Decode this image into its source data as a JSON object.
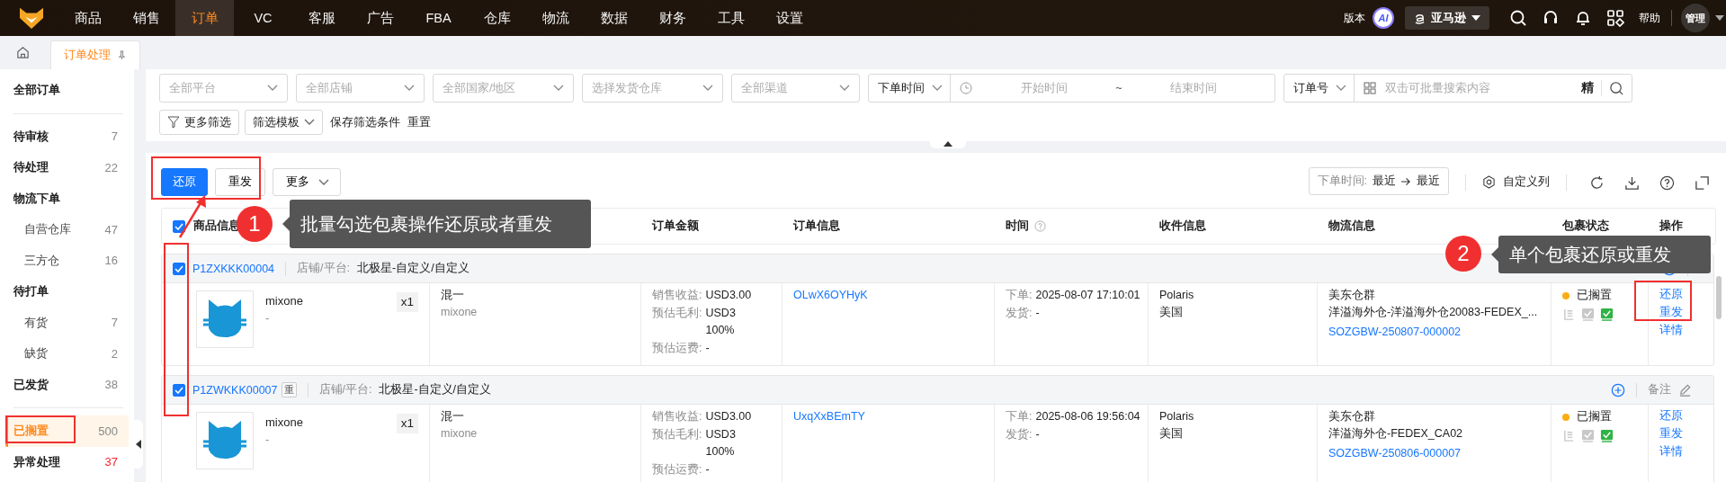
{
  "nav": {
    "items": [
      {
        "label": "商品",
        "selected": false
      },
      {
        "label": "销售",
        "selected": false
      },
      {
        "label": "订单",
        "selected": true
      },
      {
        "label": "VC",
        "selected": false
      },
      {
        "label": "客服",
        "selected": false
      },
      {
        "label": "广告",
        "selected": false
      },
      {
        "label": "FBA",
        "selected": false
      },
      {
        "label": "仓库",
        "selected": false
      },
      {
        "label": "物流",
        "selected": false
      },
      {
        "label": "数据",
        "selected": false
      },
      {
        "label": "财务",
        "selected": false
      },
      {
        "label": "工具",
        "selected": false
      },
      {
        "label": "设置",
        "selected": false
      }
    ],
    "version": "版本",
    "ai": "AI",
    "platform": "亚马逊",
    "help": "帮助",
    "user": "管理"
  },
  "tabs": [
    {
      "label": "订单处理",
      "selected": true
    }
  ],
  "sidebar": {
    "sections": [
      {
        "items": [
          {
            "label": "全部订单",
            "selected": false
          }
        ]
      },
      {
        "items": [
          {
            "label": "待审核",
            "count": "7",
            "alert": false,
            "selected": false
          },
          {
            "label": "待处理",
            "count": "22",
            "alert": false,
            "selected": false
          },
          {
            "label": "物流下单",
            "selected": false,
            "children": [
              {
                "label": "自营仓库",
                "count": "47",
                "alert": false,
                "selected": false
              },
              {
                "label": "三方仓",
                "count": "16",
                "alert": false,
                "selected": false
              }
            ]
          },
          {
            "label": "待打单",
            "selected": false,
            "children": [
              {
                "label": "有货",
                "count": "7",
                "alert": false,
                "selected": false
              },
              {
                "label": "缺货",
                "count": "2",
                "alert": false,
                "selected": false
              }
            ]
          },
          {
            "label": "已发货",
            "count": "38",
            "alert": false,
            "selected": false
          }
        ]
      },
      {
        "items": [
          {
            "label": "已搁置",
            "count": "500",
            "alert": false,
            "selected": true
          },
          {
            "label": "异常处理",
            "count": "37",
            "alert": true,
            "selected": false
          }
        ]
      }
    ]
  },
  "filters": {
    "selects": [
      {
        "placeholder": "全部平台"
      },
      {
        "placeholder": "全部店铺"
      },
      {
        "placeholder": "全部国家/地区"
      },
      {
        "placeholder": "选择发货仓库"
      },
      {
        "placeholder": "全部渠道"
      }
    ],
    "date": {
      "field": "下单时间",
      "start_placeholder": "开始时间",
      "separator": "~",
      "end_placeholder": "结束时间"
    },
    "search": {
      "field": "订单号",
      "placeholder": "双击可批量搜索内容",
      "exact": "精"
    },
    "more": "更多筛选",
    "template": "筛选模板",
    "save": "保存筛选条件",
    "reset": "重置"
  },
  "toolbar": {
    "buttons": [
      {
        "label": "还原",
        "kind": "primary"
      },
      {
        "label": "重发",
        "kind": "default"
      },
      {
        "label": "更多",
        "kind": "dropdown"
      }
    ],
    "sort": {
      "label": "下单时间:",
      "from": "最近",
      "to": "最近"
    },
    "customize": "自定义列"
  },
  "table": {
    "select_all": {
      "checked": true
    },
    "columns": [
      {
        "label": "商品信息"
      },
      {
        "label": "订单金额"
      },
      {
        "label": "订单信息"
      },
      {
        "label": "时间",
        "help": true
      },
      {
        "label": "收件信息"
      },
      {
        "label": "物流信息"
      },
      {
        "label": "包裹状态"
      },
      {
        "label": "操作"
      }
    ],
    "rows": [
      {
        "checked": true,
        "order_no": "P1ZXKKK00004",
        "shop_label": "店铺/平台:",
        "shop": "北极星-自定义/自定义",
        "product": {
          "name": "mixone",
          "sku": "-",
          "qty": "x1"
        },
        "variant": {
          "name": "混一",
          "sku": "mixone"
        },
        "amount": [
          {
            "caption": "销售收益:",
            "text": "USD3.00"
          },
          {
            "caption": "预估毛利:",
            "text": "USD3",
            "extra": "100%"
          },
          {
            "caption": "预估运费:",
            "text": "-"
          }
        ],
        "order_id": "OLwX6OYHyK",
        "time": [
          {
            "caption": "下单:",
            "text": "2025-08-07 17:10:01"
          },
          {
            "caption": "发货:",
            "text": "-"
          }
        ],
        "recipient": {
          "name": "Polaris",
          "country": "美国"
        },
        "logistics": {
          "warehouse": "美东仓群",
          "channel": "洋溢海外仓-洋溢海外仓20083-FEDEX_...",
          "tracking": "SOZGBW-250807-000002"
        },
        "status": {
          "label": "已搁置",
          "color": "#faad14",
          "flags": [
            false,
            false,
            true
          ]
        },
        "actions": [
          "还原",
          "重发",
          "详情"
        ]
      },
      {
        "checked": true,
        "order_no": "P1ZWKKK00007",
        "tag": "重",
        "shop_label": "店铺/平台:",
        "shop": "北极星-自定义/自定义",
        "note": "备注",
        "product": {
          "name": "mixone",
          "sku": "-",
          "qty": "x1"
        },
        "variant": {
          "name": "混一",
          "sku": "mixone"
        },
        "amount": [
          {
            "caption": "销售收益:",
            "text": "USD3.00"
          },
          {
            "caption": "预估毛利:",
            "text": "USD3",
            "extra": "100%"
          },
          {
            "caption": "预估运费:",
            "text": "-"
          }
        ],
        "order_id": "UxqXxBEmTY",
        "time": [
          {
            "caption": "下单:",
            "text": "2025-08-06 19:56:04"
          },
          {
            "caption": "发货:",
            "text": "-"
          }
        ],
        "recipient": {
          "name": "Polaris",
          "country": "美国"
        },
        "logistics": {
          "warehouse": "美东仓群",
          "channel": "洋溢海外仓-FEDEX_CA02",
          "tracking": "SOZGBW-250806-000007"
        },
        "status": {
          "label": "已搁置",
          "color": "#faad14",
          "flags": [
            false,
            false,
            true
          ]
        },
        "actions": [
          "还原",
          "重发",
          "详情"
        ]
      }
    ]
  },
  "annotations": [
    {
      "number": "1",
      "text": "批量勾选包裹操作还原或者重发"
    },
    {
      "number": "2",
      "text": "单个包裹还原或重发"
    }
  ]
}
